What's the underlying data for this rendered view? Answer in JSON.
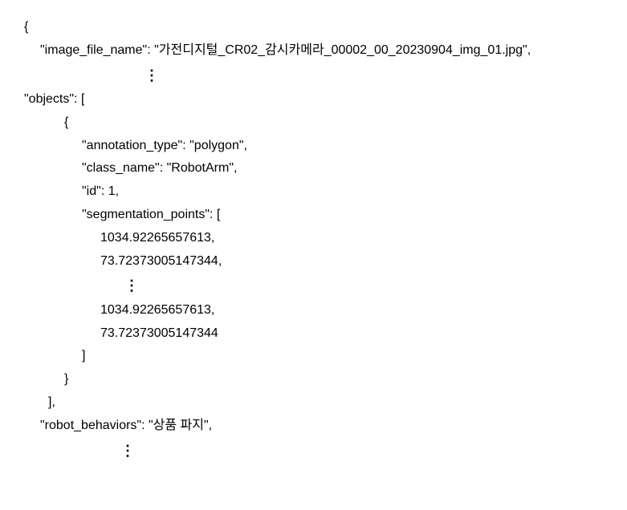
{
  "lines": {
    "l0": "{",
    "l1": "\"image_file_name\": \"가전디지털_CR02_감시카메라_00002_00_20230904_img_01.jpg\",",
    "l2": "⋮",
    "l3": "",
    "l4": "\"objects\": [",
    "l5": "{",
    "l6": "\"annotation_type\": \"polygon\",",
    "l7": "\"class_name\": \"RobotArm\",",
    "l8": "\"id\": 1,",
    "l9": "\"segmentation_points\": [",
    "l10": "1034.92265657613,",
    "l11": "73.72373005147344,",
    "l12": "⋮",
    "l13": "",
    "l14": "1034.92265657613,",
    "l15": "73.72373005147344",
    "l16": "]",
    "l17": "}",
    "l18": "],",
    "l19": "\"robot_behaviors\": \"상품 파지\",",
    "l20": "⋮"
  }
}
